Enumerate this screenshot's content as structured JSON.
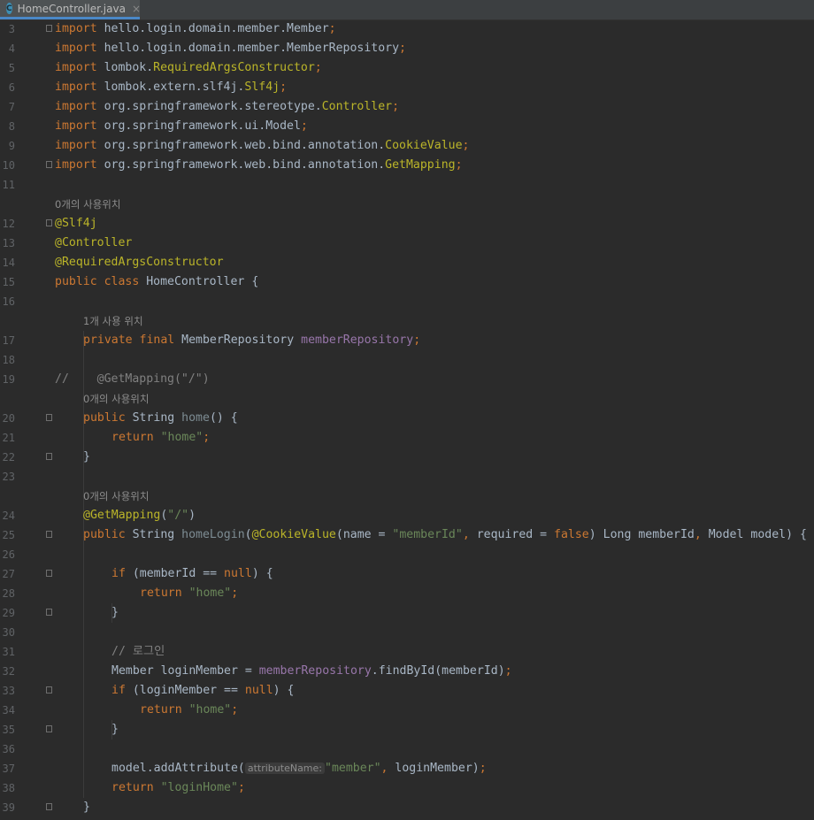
{
  "tab": {
    "icon": "C",
    "filename": "HomeController.java",
    "close": "×"
  },
  "lines": [
    {
      "n": "3",
      "indent": 0,
      "fold": true,
      "tokens": [
        [
          "k",
          "import"
        ],
        [
          "p",
          " hello.login.domain.member.Member"
        ],
        [
          "k",
          ";"
        ]
      ]
    },
    {
      "n": "4",
      "indent": 0,
      "fold": false,
      "tokens": [
        [
          "k",
          "import"
        ],
        [
          "p",
          " hello.login.domain.member.MemberRepository"
        ],
        [
          "k",
          ";"
        ]
      ]
    },
    {
      "n": "5",
      "indent": 0,
      "fold": false,
      "tokens": [
        [
          "k",
          "import"
        ],
        [
          "p",
          " lombok."
        ],
        [
          "a",
          "RequiredArgsConstructor"
        ],
        [
          "k",
          ";"
        ]
      ]
    },
    {
      "n": "6",
      "indent": 0,
      "fold": false,
      "tokens": [
        [
          "k",
          "import"
        ],
        [
          "p",
          " lombok.extern.slf4j."
        ],
        [
          "a",
          "Slf4j"
        ],
        [
          "k",
          ";"
        ]
      ]
    },
    {
      "n": "7",
      "indent": 0,
      "fold": false,
      "tokens": [
        [
          "k",
          "import"
        ],
        [
          "p",
          " org.springframework.stereotype."
        ],
        [
          "a",
          "Controller"
        ],
        [
          "k",
          ";"
        ]
      ]
    },
    {
      "n": "8",
      "indent": 0,
      "fold": false,
      "tokens": [
        [
          "k",
          "import"
        ],
        [
          "p",
          " org.springframework.ui.Model"
        ],
        [
          "k",
          ";"
        ]
      ]
    },
    {
      "n": "9",
      "indent": 0,
      "fold": false,
      "tokens": [
        [
          "k",
          "import"
        ],
        [
          "p",
          " org.springframework.web.bind.annotation."
        ],
        [
          "a",
          "CookieValue"
        ],
        [
          "k",
          ";"
        ]
      ]
    },
    {
      "n": "10",
      "indent": 0,
      "fold": true,
      "tokens": [
        [
          "k",
          "import"
        ],
        [
          "p",
          " org.springframework.web.bind.annotation."
        ],
        [
          "a",
          "GetMapping"
        ],
        [
          "k",
          ";"
        ]
      ]
    },
    {
      "n": "11",
      "indent": 0,
      "fold": false,
      "tokens": []
    },
    {
      "n": "",
      "indent": 0,
      "fold": false,
      "hint": "0개의 사용위치"
    },
    {
      "n": "12",
      "indent": 0,
      "fold": true,
      "tokens": [
        [
          "a",
          "@Slf4j"
        ]
      ]
    },
    {
      "n": "13",
      "indent": 0,
      "fold": false,
      "tokens": [
        [
          "a",
          "@Controller"
        ]
      ]
    },
    {
      "n": "14",
      "indent": 0,
      "fold": false,
      "tokens": [
        [
          "a",
          "@RequiredArgsConstructor"
        ]
      ]
    },
    {
      "n": "15",
      "indent": 0,
      "fold": false,
      "tokens": [
        [
          "k",
          "public class"
        ],
        [
          "p",
          " HomeController {"
        ]
      ]
    },
    {
      "n": "16",
      "indent": 0,
      "fold": false,
      "tokens": []
    },
    {
      "n": "",
      "indent": 1,
      "fold": false,
      "hint": "1개 사용 위치"
    },
    {
      "n": "17",
      "indent": 1,
      "fold": false,
      "tokens": [
        [
          "k",
          "private final"
        ],
        [
          "p",
          " MemberRepository "
        ],
        [
          "f",
          "memberRepository"
        ],
        [
          "k",
          ";"
        ]
      ]
    },
    {
      "n": "18",
      "indent": 0,
      "fold": false,
      "tokens": []
    },
    {
      "n": "19",
      "indent": 0,
      "fold": false,
      "tokens": [
        [
          "c",
          "//    @GetMapping(\"/\")"
        ]
      ]
    },
    {
      "n": "",
      "indent": 1,
      "fold": false,
      "hint": "0개의 사용위치"
    },
    {
      "n": "20",
      "indent": 1,
      "fold": true,
      "tokens": [
        [
          "k",
          "public"
        ],
        [
          "p",
          " String "
        ],
        [
          "m",
          "home"
        ],
        [
          "p",
          "() {"
        ]
      ]
    },
    {
      "n": "21",
      "indent": 2,
      "fold": false,
      "tokens": [
        [
          "k",
          "return"
        ],
        [
          "p",
          " "
        ],
        [
          "s",
          "\"home\""
        ],
        [
          "k",
          ";"
        ]
      ]
    },
    {
      "n": "22",
      "indent": 1,
      "fold": true,
      "tokens": [
        [
          "p",
          "}"
        ]
      ]
    },
    {
      "n": "23",
      "indent": 0,
      "fold": false,
      "tokens": []
    },
    {
      "n": "",
      "indent": 1,
      "fold": false,
      "hint": "0개의 사용위치"
    },
    {
      "n": "24",
      "indent": 1,
      "fold": false,
      "tokens": [
        [
          "a",
          "@GetMapping"
        ],
        [
          "p",
          "("
        ],
        [
          "s",
          "\"/\""
        ],
        [
          "p",
          ")"
        ]
      ]
    },
    {
      "n": "25",
      "indent": 1,
      "fold": true,
      "tokens": [
        [
          "k",
          "public"
        ],
        [
          "p",
          " String "
        ],
        [
          "m",
          "homeLogin"
        ],
        [
          "p",
          "("
        ],
        [
          "a",
          "@CookieValue"
        ],
        [
          "p",
          "(name = "
        ],
        [
          "s",
          "\"memberId\""
        ],
        [
          "k",
          ","
        ],
        [
          "p",
          " required = "
        ],
        [
          "k",
          "false"
        ],
        [
          "p",
          ") Long memberId"
        ],
        [
          "k",
          ","
        ],
        [
          "p",
          " Model model) {"
        ]
      ]
    },
    {
      "n": "26",
      "indent": 0,
      "fold": false,
      "tokens": []
    },
    {
      "n": "27",
      "indent": 2,
      "fold": true,
      "tokens": [
        [
          "k",
          "if"
        ],
        [
          "p",
          " (memberId == "
        ],
        [
          "k",
          "null"
        ],
        [
          "p",
          ") {"
        ]
      ]
    },
    {
      "n": "28",
      "indent": 3,
      "fold": false,
      "tokens": [
        [
          "k",
          "return"
        ],
        [
          "p",
          " "
        ],
        [
          "s",
          "\"home\""
        ],
        [
          "k",
          ";"
        ]
      ]
    },
    {
      "n": "29",
      "indent": 2,
      "fold": true,
      "tokens": [
        [
          "p",
          "}"
        ]
      ]
    },
    {
      "n": "30",
      "indent": 0,
      "fold": false,
      "tokens": []
    },
    {
      "n": "31",
      "indent": 2,
      "fold": false,
      "tokens": [
        [
          "c",
          "// 로그인"
        ]
      ]
    },
    {
      "n": "32",
      "indent": 2,
      "fold": false,
      "tokens": [
        [
          "p",
          "Member loginMember = "
        ],
        [
          "f",
          "memberRepository"
        ],
        [
          "p",
          ".findById(memberId)"
        ],
        [
          "k",
          ";"
        ]
      ]
    },
    {
      "n": "33",
      "indent": 2,
      "fold": true,
      "tokens": [
        [
          "k",
          "if"
        ],
        [
          "p",
          " (loginMember == "
        ],
        [
          "k",
          "null"
        ],
        [
          "p",
          ") {"
        ]
      ]
    },
    {
      "n": "34",
      "indent": 3,
      "fold": false,
      "tokens": [
        [
          "k",
          "return"
        ],
        [
          "p",
          " "
        ],
        [
          "s",
          "\"home\""
        ],
        [
          "k",
          ";"
        ]
      ]
    },
    {
      "n": "35",
      "indent": 2,
      "fold": true,
      "tokens": [
        [
          "p",
          "}"
        ]
      ]
    },
    {
      "n": "36",
      "indent": 0,
      "fold": false,
      "tokens": []
    },
    {
      "n": "37",
      "indent": 2,
      "fold": false,
      "tokens": [
        [
          "p",
          "model.addAttribute("
        ],
        [
          "param",
          "attributeName:"
        ],
        [
          "s",
          "\"member\""
        ],
        [
          "k",
          ","
        ],
        [
          "p",
          " loginMember)"
        ],
        [
          "k",
          ";"
        ]
      ]
    },
    {
      "n": "38",
      "indent": 2,
      "fold": false,
      "tokens": [
        [
          "k",
          "return"
        ],
        [
          "p",
          " "
        ],
        [
          "s",
          "\"loginHome\""
        ],
        [
          "k",
          ";"
        ]
      ]
    },
    {
      "n": "39",
      "indent": 1,
      "fold": true,
      "tokens": [
        [
          "p",
          "}"
        ]
      ]
    }
  ]
}
